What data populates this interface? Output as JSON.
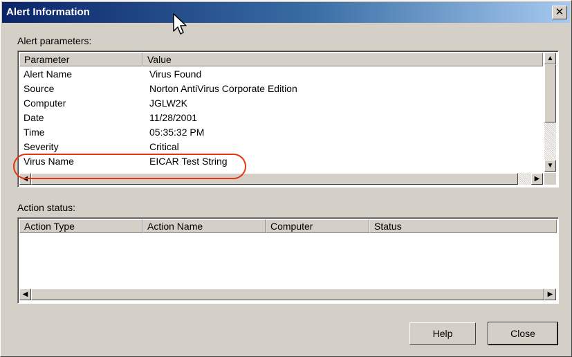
{
  "window": {
    "title": "Alert Information",
    "close_glyph": "✕"
  },
  "alert_parameters": {
    "label": "Alert parameters:",
    "columns": [
      "Parameter",
      "Value"
    ],
    "rows": [
      {
        "parameter": "Alert Name",
        "value": "Virus Found"
      },
      {
        "parameter": "Source",
        "value": "Norton AntiVirus Corporate Edition"
      },
      {
        "parameter": "Computer",
        "value": "JGLW2K"
      },
      {
        "parameter": "Date",
        "value": "11/28/2001"
      },
      {
        "parameter": "Time",
        "value": "05:35:32 PM"
      },
      {
        "parameter": "Severity",
        "value": "Critical"
      },
      {
        "parameter": "Virus Name",
        "value": "EICAR Test String"
      }
    ],
    "highlighted_row": "Virus Name",
    "highlight_color": "#e8330f"
  },
  "action_status": {
    "label": "Action status:",
    "columns": [
      "Action Type",
      "Action Name",
      "Computer",
      "Status"
    ],
    "rows": []
  },
  "buttons": {
    "help": "Help",
    "close": "Close"
  },
  "icons": {
    "arrow_up": "▲",
    "arrow_down": "▼",
    "arrow_left": "◀",
    "arrow_right": "▶",
    "cursor": "mouse-pointer-icon"
  },
  "colors": {
    "titlebar_start": "#0a246a",
    "titlebar_end": "#a6caf0",
    "face": "#d4d0c8"
  }
}
